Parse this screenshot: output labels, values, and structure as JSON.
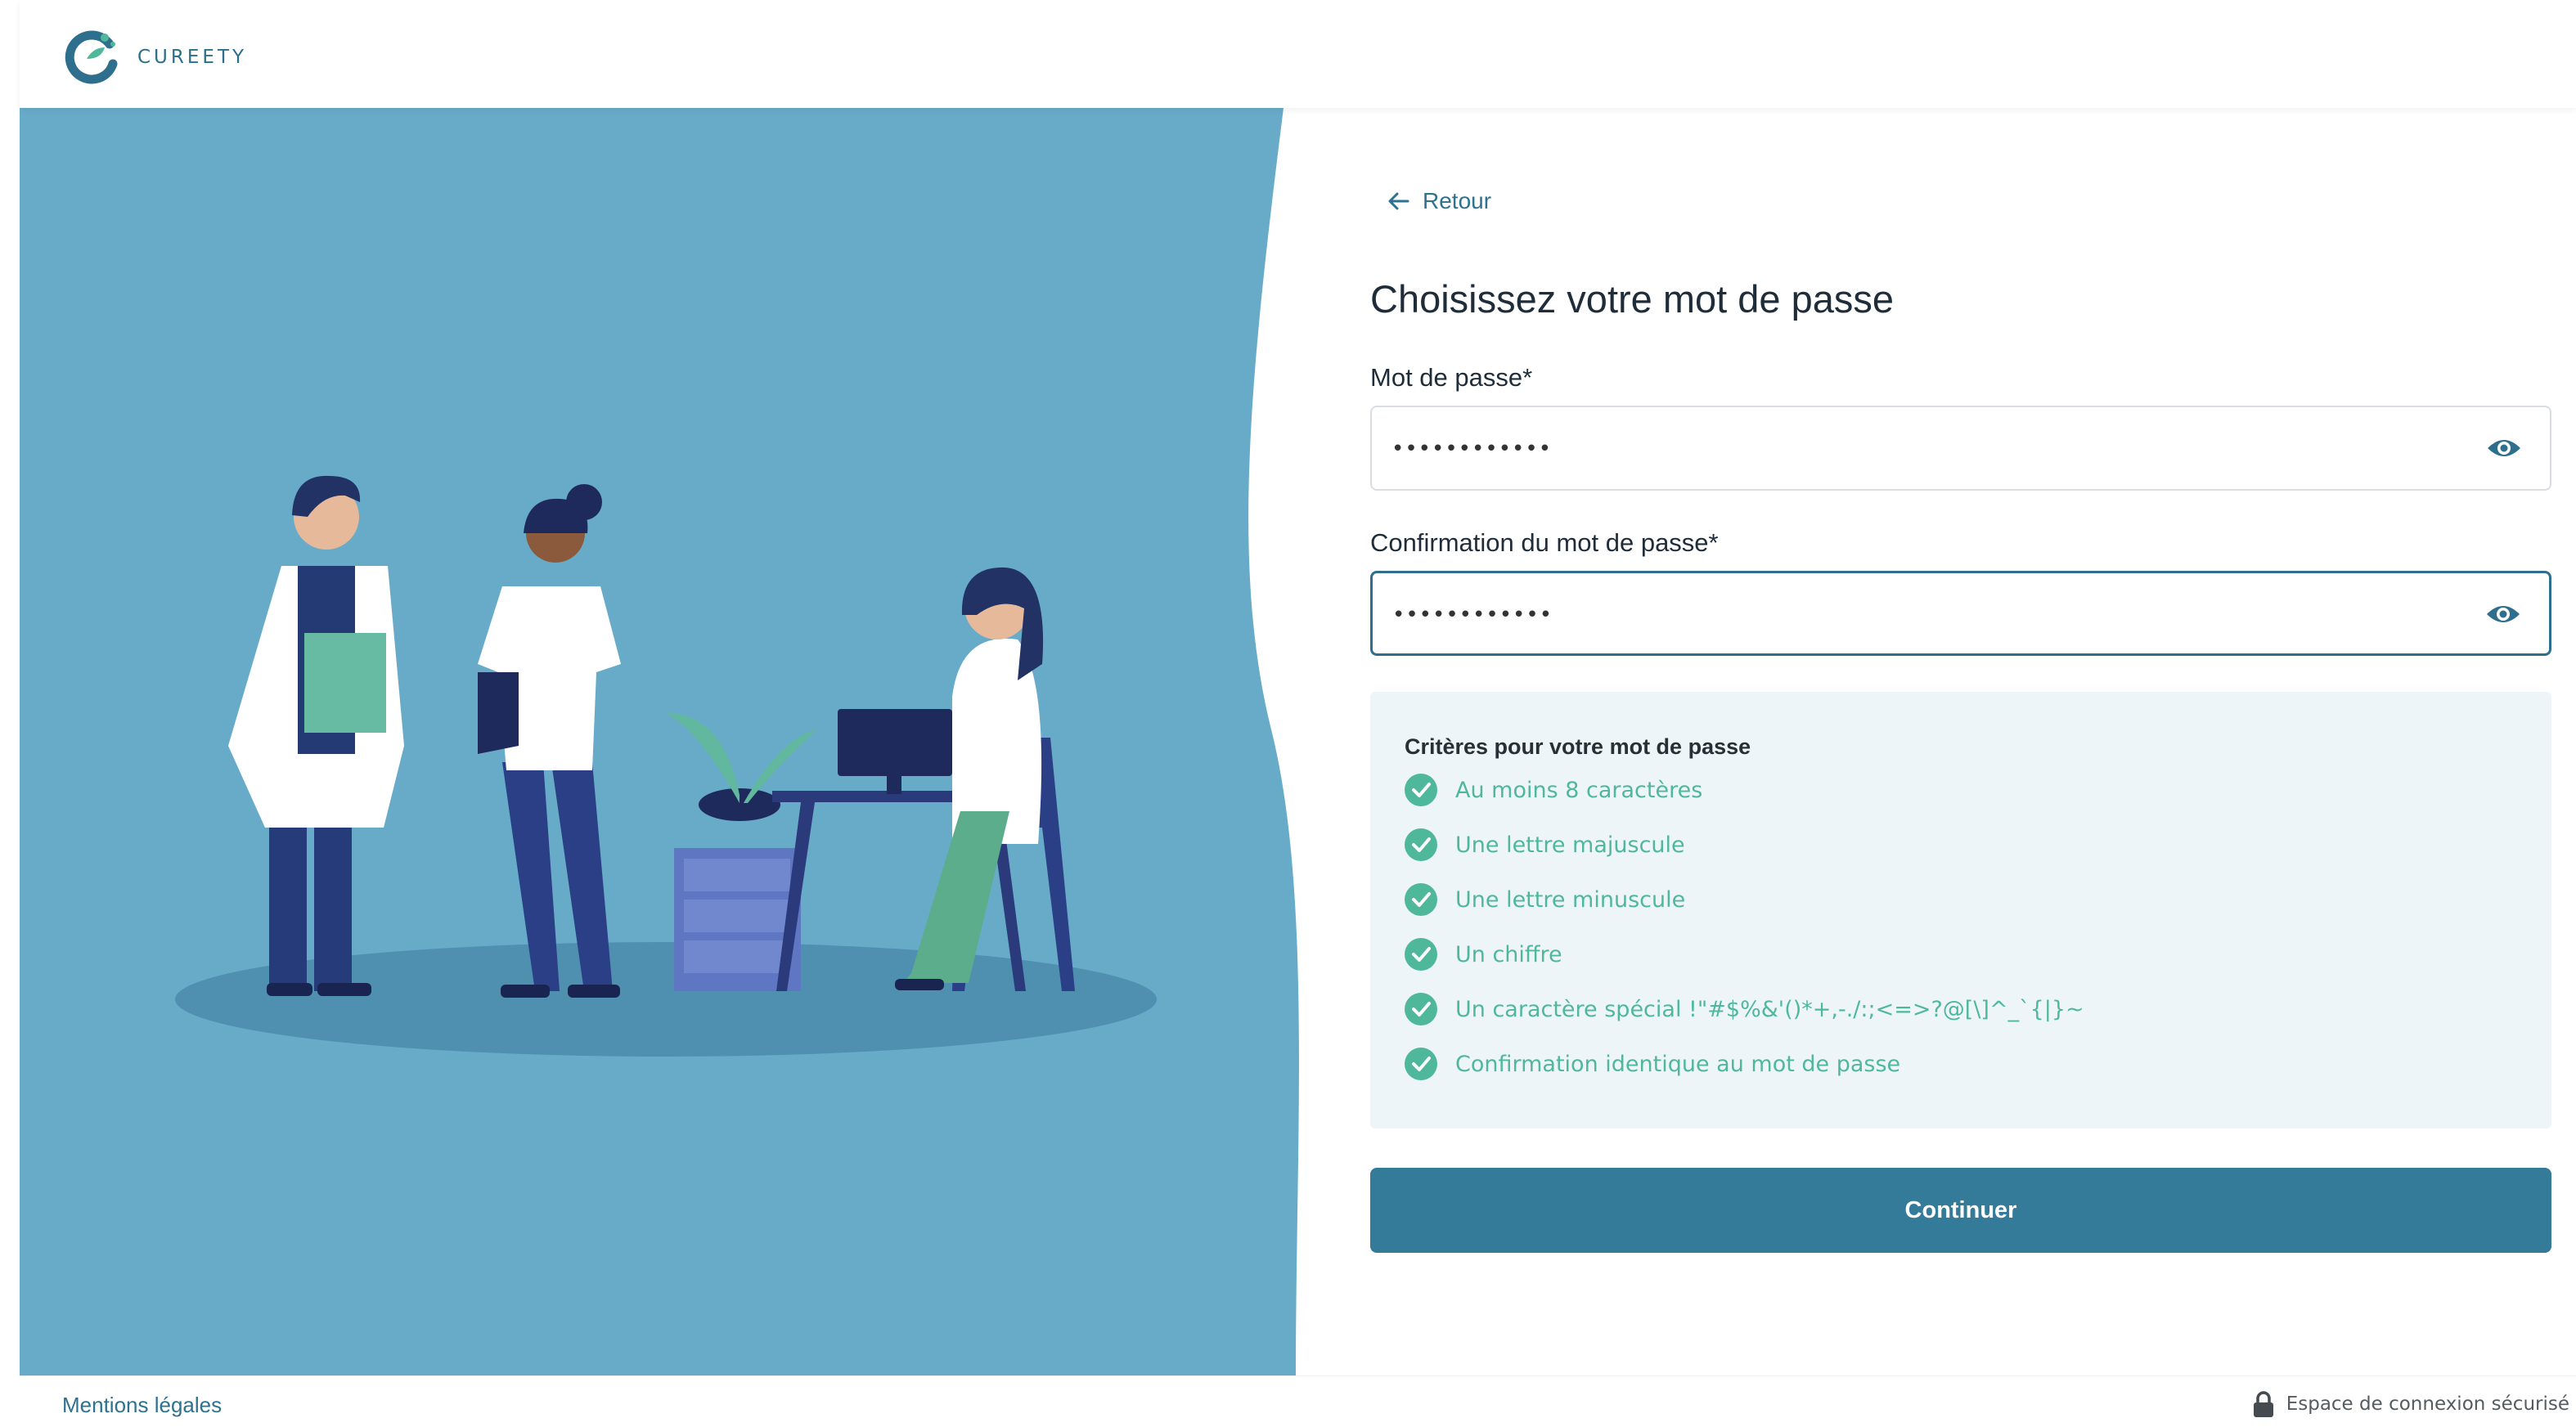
{
  "brand": {
    "name": "CUREETY"
  },
  "form": {
    "back_label": "Retour",
    "title": "Choisissez votre mot de passe",
    "password": {
      "label": "Mot de passe*",
      "value": "••••••••••••"
    },
    "confirm": {
      "label": "Confirmation du mot de passe*",
      "value": "••••••••••••"
    },
    "criteria": {
      "title": "Critères pour votre mot de passe",
      "items": [
        {
          "label": "Au moins 8 caractères"
        },
        {
          "label": "Une lettre majuscule"
        },
        {
          "label": "Une lettre minuscule"
        },
        {
          "label": "Un chiffre"
        },
        {
          "label": "Un caractère spécial !\"#$%&'()*+,-./:;<=>?@[\\]^_`{|}~"
        },
        {
          "label": "Confirmation identique au mot de passe"
        }
      ]
    },
    "submit_label": "Continuer"
  },
  "footer": {
    "legal_label": "Mentions légales",
    "secure_label": "Espace de connexion sécurisé"
  },
  "colors": {
    "primary": "#347a99",
    "illustration_bg": "#68abc9",
    "check": "#4fb89a",
    "criteria_bg": "#eef5f9"
  },
  "icons": [
    "back-arrow-icon",
    "eye-icon",
    "check-circle-icon",
    "lock-icon"
  ]
}
